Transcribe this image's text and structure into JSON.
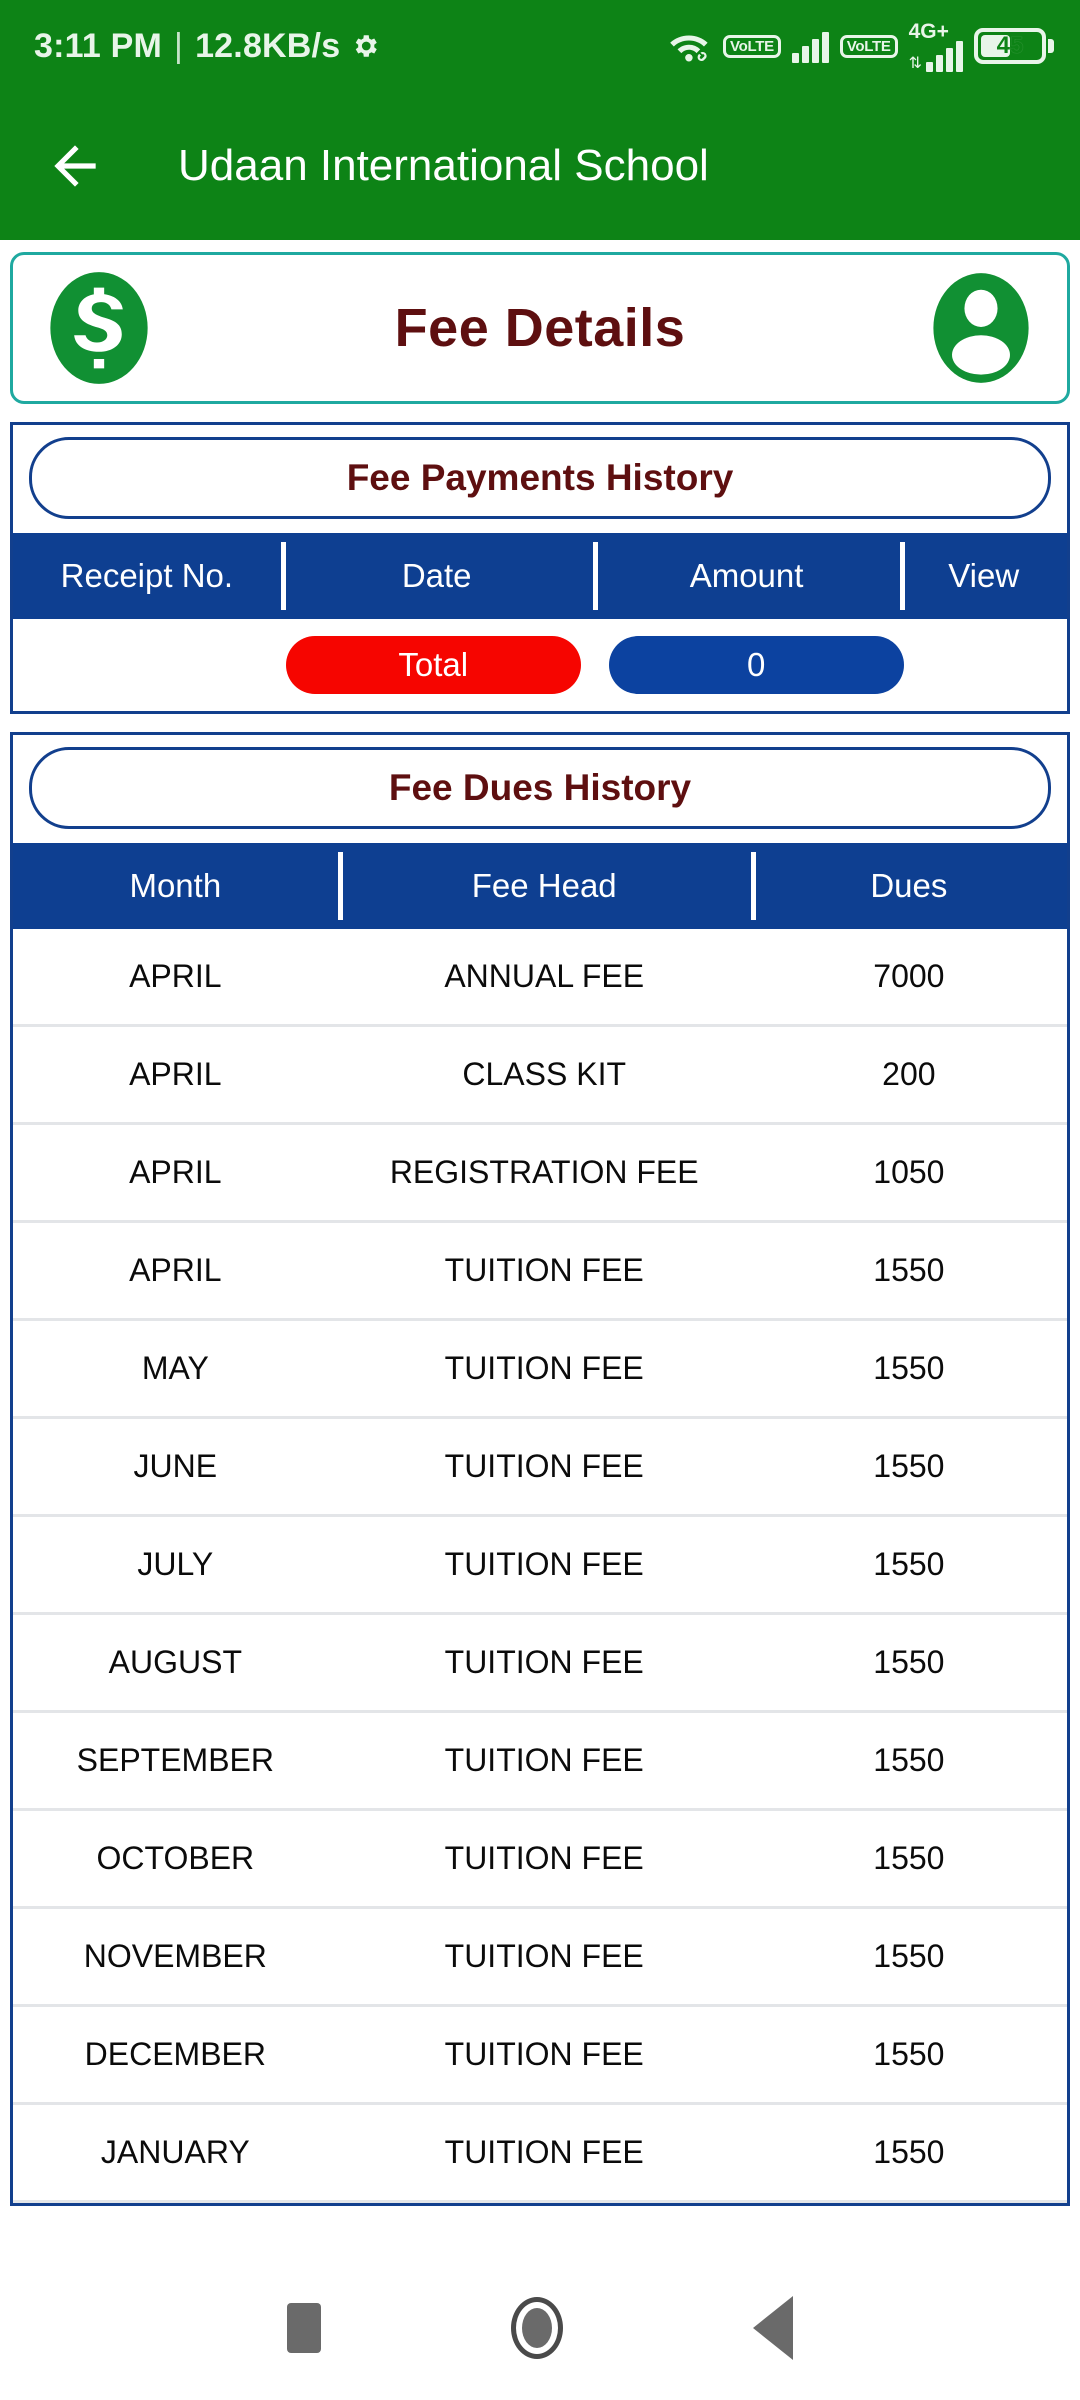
{
  "status_bar": {
    "time": "3:11 PM",
    "separator": "|",
    "net_speed": "12.8KB/s",
    "gear_icon": "gear-icon",
    "wifi_icon": "wifi-link-icon",
    "volte_line1": "Vo",
    "volte_line2": "LTE",
    "network_type": "4G+",
    "data_arrows": "⇅",
    "battery_level": "45"
  },
  "app_bar": {
    "back_icon": "back-arrow-icon",
    "title": "Udaan International School"
  },
  "fee_header": {
    "money_icon": "dollar-circle-icon",
    "title": "Fee Details",
    "profile_icon": "person-avatar-icon"
  },
  "payments_panel": {
    "title": "Fee Payments History",
    "columns": [
      "Receipt No.",
      "Date",
      "Amount",
      "View"
    ],
    "rows": [],
    "total_label": "Total",
    "total_value": "0"
  },
  "dues_panel": {
    "title": "Fee Dues History",
    "columns": [
      "Month",
      "Fee Head",
      "Dues"
    ],
    "rows": [
      [
        "APRIL",
        "ANNUAL FEE",
        "7000"
      ],
      [
        "APRIL",
        "CLASS KIT",
        "200"
      ],
      [
        "APRIL",
        "REGISTRATION FEE",
        "1050"
      ],
      [
        "APRIL",
        "TUITION FEE",
        "1550"
      ],
      [
        "MAY",
        "TUITION FEE",
        "1550"
      ],
      [
        "JUNE",
        "TUITION FEE",
        "1550"
      ],
      [
        "JULY",
        "TUITION FEE",
        "1550"
      ],
      [
        "AUGUST",
        "TUITION FEE",
        "1550"
      ],
      [
        "SEPTEMBER",
        "TUITION FEE",
        "1550"
      ],
      [
        "OCTOBER",
        "TUITION FEE",
        "1550"
      ],
      [
        "NOVEMBER",
        "TUITION FEE",
        "1550"
      ],
      [
        "DECEMBER",
        "TUITION FEE",
        "1550"
      ],
      [
        "JANUARY",
        "TUITION FEE",
        "1550"
      ]
    ]
  },
  "nav_bar": {
    "recents_icon": "square-recents-icon",
    "home_icon": "circle-home-icon",
    "back_icon": "triangle-back-icon"
  },
  "colors": {
    "green_header": "#0d8316",
    "blue_table": "#0e3f91",
    "blue_border": "#123f8d",
    "teal_border": "#1fa9a0",
    "maroon_text": "#5e0f10",
    "red_pill": "#f60500",
    "blue_pill": "#0c42a0",
    "icon_green": "#119033"
  }
}
